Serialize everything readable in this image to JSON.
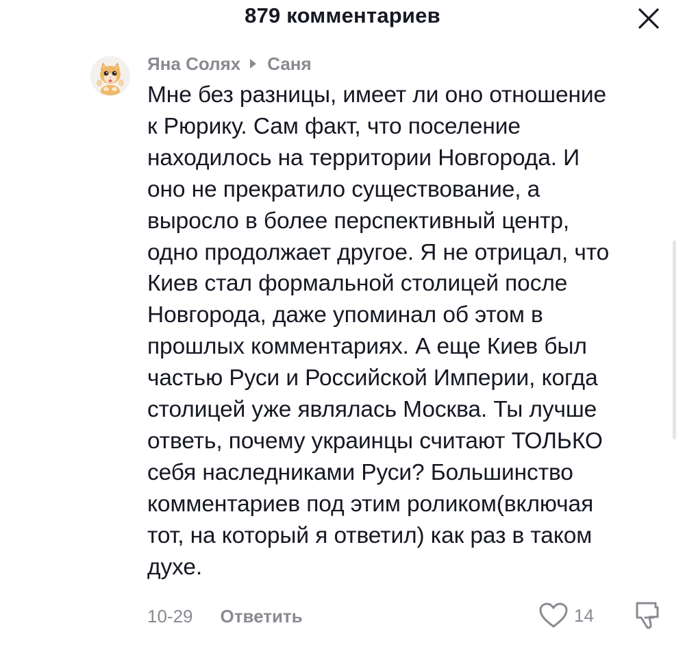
{
  "header": {
    "title": "879 комментариев",
    "close_icon": "close-icon"
  },
  "comment": {
    "author": "Яна Солях",
    "reply_to": "Саня",
    "text": "Мне без разницы, имеет ли оно отношение\nк Рюрику. Сам факт, что поселение\nнаходилось на территории Новгорода. И\nоно не прекратило существование, а\nвыросло в более перспективный центр,\nодно продолжает другое. Я не отрицал, что\nКиев стал формальной столицей после\nНовгорода, даже упоминал об этом в\nпрошлых комментариях. А еще Киев был\nчастью Руси и Российской Империи, когда\nстолицей уже являлась Москва. Ты лучше\nответь, почему украинцы считают ТОЛЬКО\nсебя наследниками Руси? Большинство\nкомментариев под этим роликом(включая\nтот, на который я ответил) как раз в таком\nдухе.",
    "date": "10-29",
    "reply_label": "Ответить",
    "like_count": "14",
    "icons": {
      "avatar": "cat-avatar",
      "like": "heart-icon",
      "dislike": "dislike-icon",
      "reply_arrow": "triangle-right-icon"
    }
  },
  "colors": {
    "text": "#161823",
    "secondary": "#8a8b91",
    "background": "#ffffff"
  }
}
